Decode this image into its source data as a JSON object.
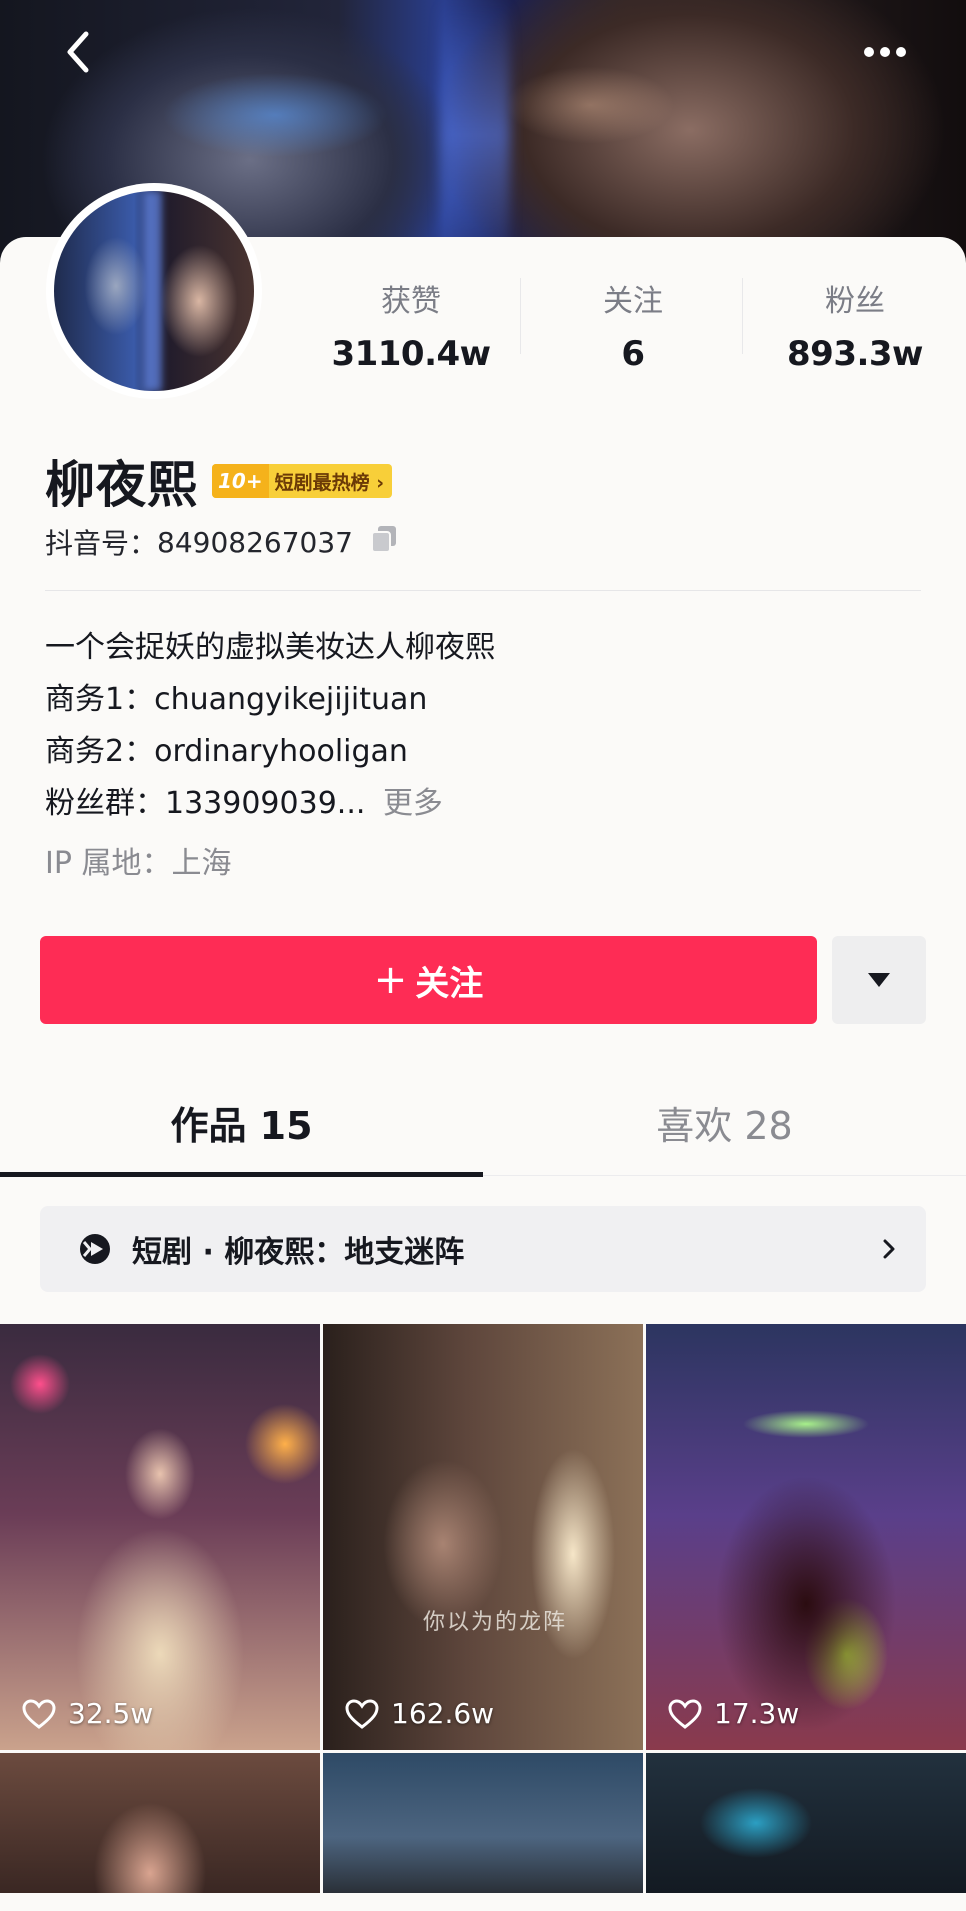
{
  "header": {
    "back_icon": "chevron-left-icon",
    "more_icon": "more-dots-icon"
  },
  "profile": {
    "stats": [
      {
        "label": "获赞",
        "value": "3110.4w"
      },
      {
        "label": "关注",
        "value": "6"
      },
      {
        "label": "粉丝",
        "value": "893.3w"
      }
    ],
    "name": "柳夜熙",
    "badge": {
      "rank": "10+",
      "text": "短剧最热榜 ›"
    },
    "douyin_id_label": "抖音号：",
    "douyin_id": "84908267037",
    "bio": [
      "一个会捉妖的虚拟美妆达人柳夜熙",
      "商务1：chuangyikejijituan",
      "商务2：ordinaryhooligan",
      "粉丝群：133909039..."
    ],
    "bio_more": "更多",
    "ip_location": "IP 属地：上海"
  },
  "actions": {
    "follow_label": "关注",
    "follow_plus": "+",
    "accent_color": "#fe2c55"
  },
  "tabs": [
    {
      "label": "作品 15",
      "active": true
    },
    {
      "label": "喜欢 28",
      "active": false
    }
  ],
  "drama": {
    "label": "短剧 · 柳夜熙：地支迷阵"
  },
  "videos": [
    {
      "likes": "32.5w"
    },
    {
      "likes": "162.6w",
      "subtitle": "你以为的龙阵"
    },
    {
      "likes": "17.3w"
    },
    {
      "likes": ""
    },
    {
      "likes": ""
    },
    {
      "likes": ""
    }
  ]
}
